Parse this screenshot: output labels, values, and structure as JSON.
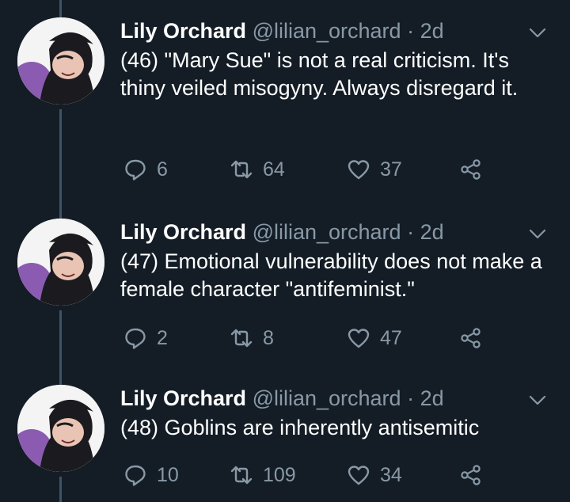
{
  "icon_color": "#8899a6",
  "background": "#141d26",
  "tweets": [
    {
      "author_name": "Lily Orchard",
      "author_handle": "@lilian_orchard",
      "separator": "·",
      "time": "2d",
      "text": "(46) \"Mary Sue\" is not a real criticism. It's thiny veiled misogyny. Always disregard it.",
      "replies": "6",
      "retweets": "64",
      "likes": "37"
    },
    {
      "author_name": "Lily Orchard",
      "author_handle": "@lilian_orchard",
      "separator": "·",
      "time": "2d",
      "text": "(47) Emotional vulnerability does not make a female character \"antifeminist.\"",
      "replies": "2",
      "retweets": "8",
      "likes": "47"
    },
    {
      "author_name": "Lily Orchard",
      "author_handle": "@lilian_orchard",
      "separator": "·",
      "time": "2d",
      "text": "(48) Goblins are inherently antisemitic",
      "replies": "10",
      "retweets": "109",
      "likes": "34"
    }
  ]
}
